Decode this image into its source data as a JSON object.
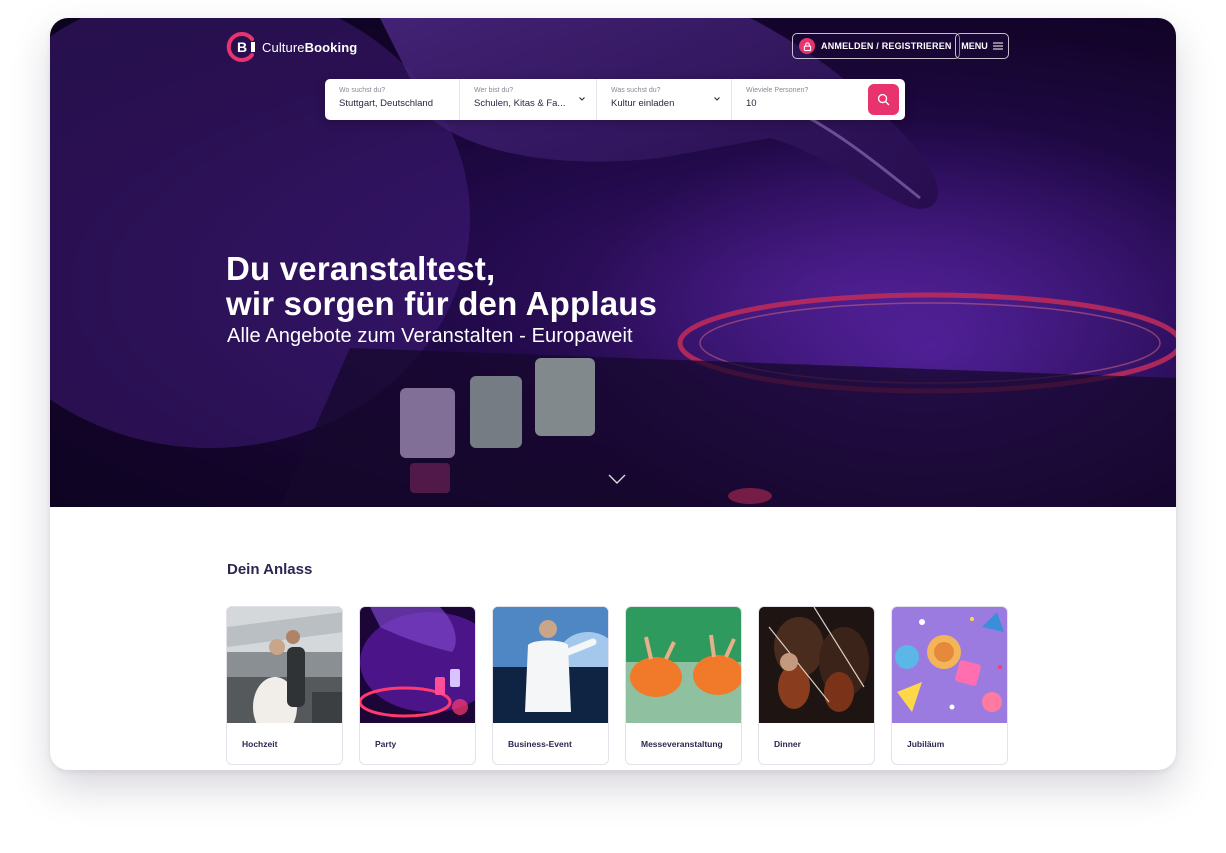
{
  "header": {
    "logo_letter": "B",
    "logo_name_light": "Culture",
    "logo_name_bold": "Booking",
    "login_label": "ANMELDEN / REGISTRIEREN",
    "menu_label": "MENU"
  },
  "search": {
    "where": {
      "label": "Wo suchst du?",
      "value": "Stuttgart, Deutschland"
    },
    "who": {
      "label": "Wer bist du?",
      "value": "Schulen, Kitas & Fa..."
    },
    "what": {
      "label": "Was suchst du?",
      "value": "Kultur einladen"
    },
    "persons": {
      "label": "Wieviele Personen?",
      "value": "10"
    }
  },
  "hero": {
    "headline_line1": "Du veranstaltest,",
    "headline_line2": "wir sorgen für den Applaus",
    "subline": "Alle Angebote zum Veranstalten - Europaweit"
  },
  "occasions": {
    "title": "Dein Anlass",
    "items": [
      {
        "label": "Hochzeit",
        "icon": "wedding-photo"
      },
      {
        "label": "Party",
        "icon": "dj-photo"
      },
      {
        "label": "Business-Event",
        "icon": "speaker-photo"
      },
      {
        "label": "Messeveranstaltung",
        "icon": "dancers-photo"
      },
      {
        "label": "Dinner",
        "icon": "violin-photo"
      },
      {
        "label": "Jubiläum",
        "icon": "party-table-photo"
      }
    ]
  },
  "colors": {
    "accent": "#e8336e",
    "title": "#2e2650",
    "hero": "#2a0c5c"
  }
}
